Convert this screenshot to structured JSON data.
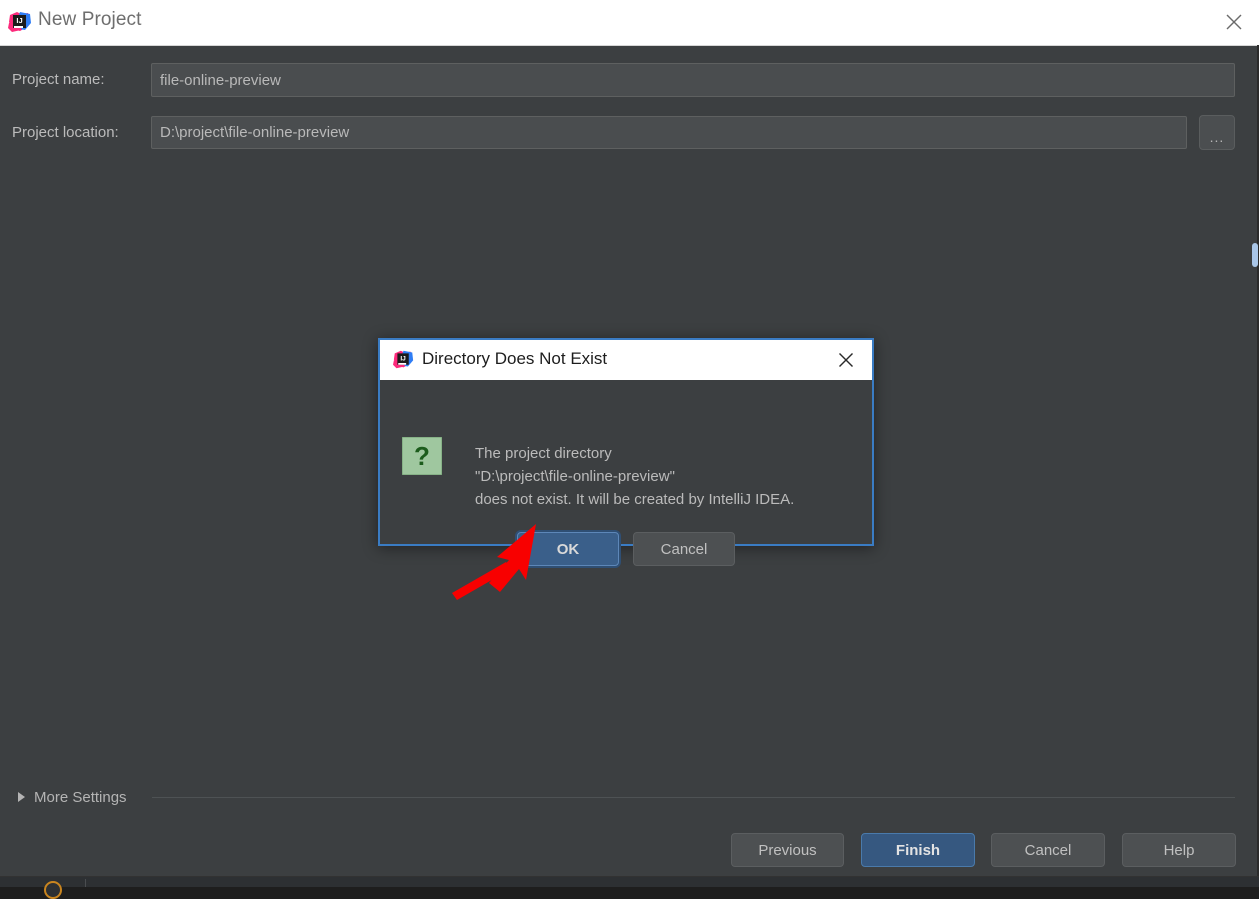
{
  "window": {
    "title": "New Project",
    "icon": "intellij-idea-icon",
    "close_icon": "close-icon"
  },
  "form": {
    "project_name": {
      "label": "Project name:",
      "value": "file-online-preview",
      "placeholder": ""
    },
    "project_location": {
      "label": "Project location:",
      "value": "D:\\project\\file-online-preview",
      "placeholder": ""
    },
    "browse_button": {
      "label": "...",
      "icon": "ellipsis-icon"
    }
  },
  "more_settings": {
    "label": "More Settings",
    "icon": "chevron-right-icon",
    "expanded": false
  },
  "footer": {
    "previous_label": "Previous",
    "finish_label": "Finish",
    "cancel_label": "Cancel",
    "help_label": "Help"
  },
  "dialog": {
    "title": "Directory Does Not Exist",
    "icon": "intellij-idea-icon",
    "close_icon": "close-icon",
    "question_icon": "question-mark-icon",
    "message_line1": "The project directory",
    "message_line2": "\"D:\\project\\file-online-preview\"",
    "message_line3": "does not exist. It will be created by IntelliJ IDEA.",
    "ok_label": "OK",
    "cancel_label": "Cancel"
  },
  "annotation": {
    "arrow": "red-arrow-pointing-to-ok-button"
  },
  "colors": {
    "accent_blue": "#365880",
    "dialog_border": "#3a7cc4",
    "background": "#3c3f41",
    "titlebar": "#ffffff",
    "text": "#bbbbbb",
    "annotation_red": "#f80000",
    "question_icon_green": "#9cc79c"
  }
}
